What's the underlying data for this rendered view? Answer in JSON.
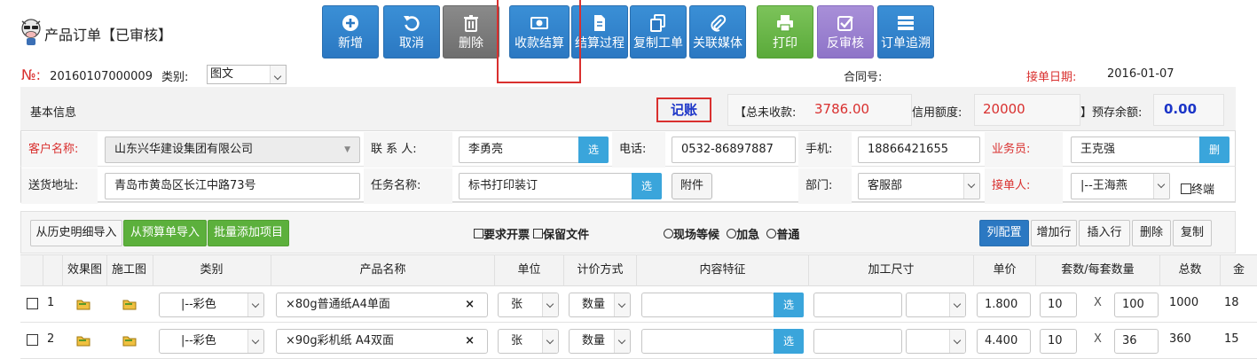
{
  "header": {
    "title": "产品订单【已审核】"
  },
  "toolbar": [
    {
      "id": "add",
      "label": "新增",
      "color": "blue",
      "icon": "plus-circle-icon"
    },
    {
      "id": "cancel",
      "label": "取消",
      "color": "blue",
      "icon": "undo-icon"
    },
    {
      "id": "delete",
      "label": "删除",
      "color": "gray",
      "icon": "trash-icon"
    },
    {
      "id": "payment",
      "label": "收款结算",
      "color": "blue",
      "icon": "money-icon"
    },
    {
      "id": "process",
      "label": "结算过程",
      "color": "blue",
      "icon": "document-icon"
    },
    {
      "id": "copy",
      "label": "复制工单",
      "color": "blue",
      "icon": "copy-icon"
    },
    {
      "id": "media",
      "label": "关联媒体",
      "color": "blue",
      "icon": "paperclip-icon"
    },
    {
      "id": "print",
      "label": "打印",
      "color": "green",
      "icon": "printer-icon"
    },
    {
      "id": "unaudit",
      "label": "反审核",
      "color": "purple",
      "icon": "checkbox-icon"
    },
    {
      "id": "trace",
      "label": "订单追溯",
      "color": "blue",
      "icon": "list-icon"
    }
  ],
  "order": {
    "no_label": "№:",
    "no_value": "20160107000009",
    "type_label": "类别:",
    "type_value": "图文",
    "contract_label": "合同号:",
    "date_label": "接单日期:",
    "date_value": "2016-01-07"
  },
  "summary": {
    "section": "基本信息",
    "bookkeeping": "记账",
    "unpaid_label": "【总未收款:",
    "unpaid_value": "3786.00",
    "credit_label": "信用额度:",
    "credit_value": "20000",
    "prepaid_label": "】预存余额:",
    "prepaid_value": "0.00"
  },
  "form": {
    "customer_label": "客户名称:",
    "customer_value": "山东兴华建设集团有限公司",
    "contact_label": "联 系 人:",
    "contact_value": "李勇亮",
    "phone_label": "电话:",
    "phone_value": "0532-86897887",
    "mobile_label": "手机:",
    "mobile_value": "18866421655",
    "sales_label": "业务员:",
    "sales_value": "王克强",
    "address_label": "送货地址:",
    "address_value": "青岛市黄岛区长江中路73号",
    "task_label": "任务名称:",
    "task_value": "标书打印装订",
    "attach_label": "附件",
    "dept_label": "部门:",
    "dept_value": "客服部",
    "receiver_label": "接单人:",
    "receiver_value": "|--王海燕",
    "terminal_label": "终端",
    "select_btn": "选",
    "delete_btn": "删"
  },
  "items_toolbar": {
    "history_import": "从历史明细导入",
    "budget_import": "从预算单导入",
    "batch_add": "批量添加项目",
    "need_invoice": "要求开票",
    "keep_files": "保留文件",
    "onsite": "现场等候",
    "urgent": "加急",
    "normal": "普通",
    "col_config": "列配置",
    "add_row": "增加行",
    "insert_row": "插入行",
    "delete": "删除",
    "copy": "复制"
  },
  "table": {
    "headers": [
      "效果图",
      "施工图",
      "类别",
      "产品名称",
      "单位",
      "计价方式",
      "内容特征",
      "加工尺寸",
      "单价",
      "套数/每套数量",
      "总数",
      "金"
    ],
    "rows": [
      {
        "index": "1",
        "category": "|--彩色",
        "product": "×80g普通纸A4单面",
        "unit": "张",
        "pricing": "数量",
        "price": "1.800",
        "sets": "10",
        "x": "X",
        "per_set": "100",
        "total": "1000",
        "amount": "18"
      },
      {
        "index": "2",
        "category": "|--彩色",
        "product": "×90g彩机纸 A4双面",
        "unit": "张",
        "pricing": "数量",
        "price": "4.400",
        "sets": "10",
        "x": "X",
        "per_set": "36",
        "total": "360",
        "amount": "15"
      }
    ],
    "clear_mark": "×"
  }
}
